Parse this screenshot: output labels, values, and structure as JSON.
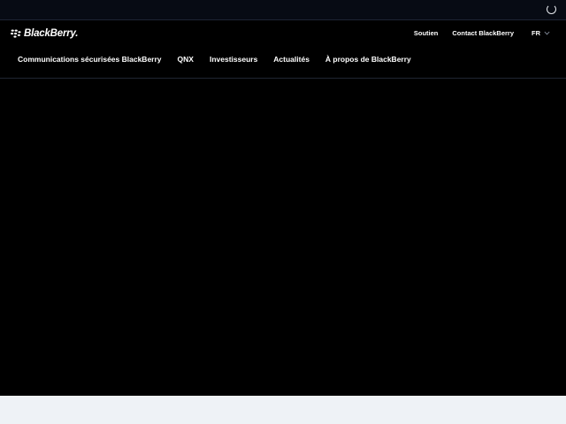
{
  "brand": {
    "name": "BlackBerry."
  },
  "utility_nav": {
    "support_label": "Soutien",
    "contact_label": "Contact BlackBerry",
    "language_label": "FR"
  },
  "main_nav": {
    "items": [
      {
        "label": "Communications sécurisées BlackBerry"
      },
      {
        "label": "QNX"
      },
      {
        "label": "Investisseurs"
      },
      {
        "label": "Actualités"
      },
      {
        "label": "À propos de BlackBerry"
      }
    ]
  },
  "icons": {
    "loading": "loading-spinner-icon",
    "logo": "blackberry-logo-icon",
    "language_dropdown": "chevron-down-icon"
  },
  "colors": {
    "page_background": "#000000",
    "top_bar": "#070b14",
    "text": "#ffffff",
    "bottom_band": "#eef2f6"
  }
}
